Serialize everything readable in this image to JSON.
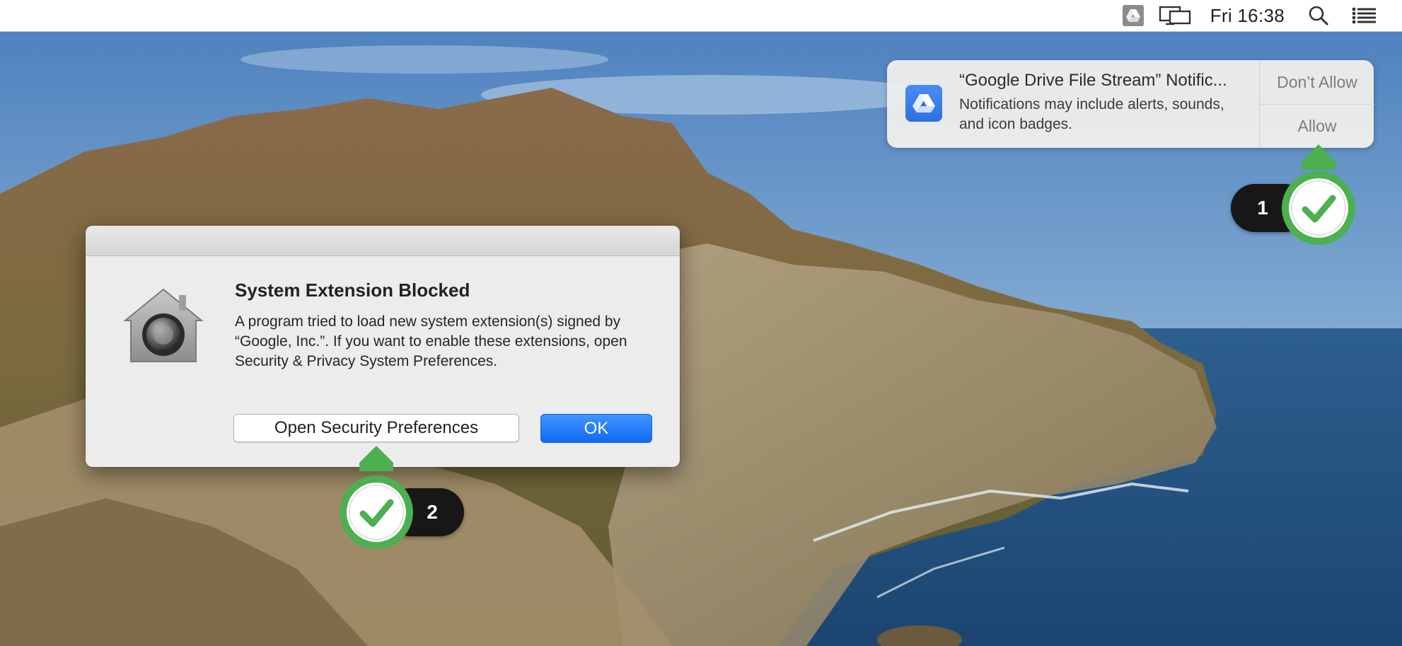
{
  "menubar": {
    "clock": "Fri 16:38",
    "icons": [
      "google-drive-icon",
      "display-mirroring-icon",
      "search-icon",
      "notification-center-icon"
    ]
  },
  "notification": {
    "app_icon": "google-drive-icon",
    "title": "“Google Drive File Stream” Notific...",
    "body": "Notifications may include alerts, sounds, and icon badges.",
    "dont_allow_label": "Don’t Allow",
    "allow_label": "Allow"
  },
  "dialog": {
    "icon": "gatekeeper-lock-icon",
    "title": "System Extension Blocked",
    "message": "A program tried to load new system extension(s) signed by “Google, Inc.”.  If you want to enable these extensions, open Security & Privacy System Preferences.",
    "secondary_button": "Open Security Preferences",
    "primary_button": "OK"
  },
  "callouts": [
    {
      "number": "1",
      "icon": "checkmark-icon",
      "color": "#4caf50"
    },
    {
      "number": "2",
      "icon": "checkmark-icon",
      "color": "#4caf50"
    }
  ],
  "colors": {
    "primary_button": "#1a73f5",
    "callout_green": "#4caf50",
    "callout_pill": "#171717"
  }
}
